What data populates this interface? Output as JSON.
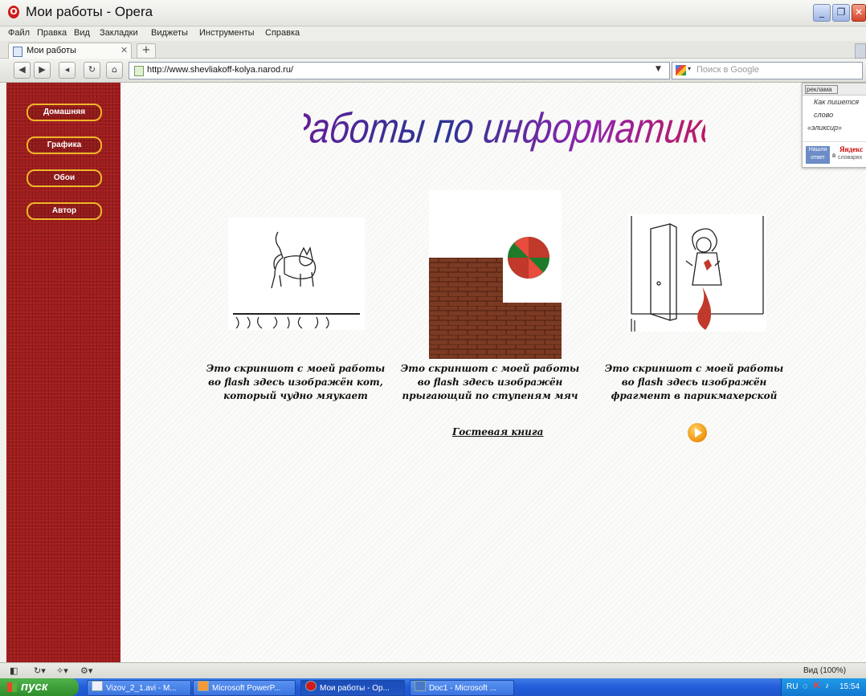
{
  "window": {
    "title": "Мои работы - Opera",
    "logo": "O",
    "buttons": [
      "_",
      "❐",
      "✕"
    ]
  },
  "menu": [
    "Файл",
    "Правка",
    "Вид",
    "Закладки",
    "Виджеты",
    "Инструменты",
    "Справка"
  ],
  "tabs": [
    {
      "label": "Мои работы",
      "close": "✕"
    }
  ],
  "tab_new": "+",
  "nav": {
    "back": "◀",
    "forward": "▶",
    "rewind": "◂",
    "reload": "↻",
    "home": "⌂",
    "url": "http://www.shevliakoff-kolya.narod.ru/",
    "url_dropdown": "▼",
    "search_caret": "▾",
    "search_placeholder": "Поиск в Google"
  },
  "sidebar": {
    "items": [
      "Домашняя",
      "Графика",
      "Обои",
      "Автор"
    ]
  },
  "heading": "Работы по информатике",
  "works": [
    {
      "caption": "Это скриншот с моей работы во flash здесь изображён кот, который чудно мяукает"
    },
    {
      "caption": "Это скриншот с моей работы во flash здесь изображён прыгающий по ступеням мяч"
    },
    {
      "caption": "Это скриншот с моей работы во flash здесь изображён фрагмент в парикмахерской"
    }
  ],
  "guestbook": "Гостевая книга",
  "ad": {
    "tag": "реклама",
    "lines": [
      "Как пишется",
      "слово",
      "«эликсир»"
    ],
    "blue": "Нашли ответ",
    "brand_pre": "в",
    "brand": "Яндекс",
    "brand_sub": "словарях"
  },
  "status": {
    "zoom": "Вид (100%)"
  },
  "taskbar": {
    "start": "пуск",
    "tasks": [
      "Vizov_2_1.avi - M...",
      "Microsoft PowerP...",
      "Мои работы - Op...",
      "Doc1 - Microsoft ..."
    ],
    "lang": "RU",
    "time": "15:54"
  },
  "colors": {
    "sidebar": "#9e1a1a",
    "button_border": "#f0b62a",
    "taskbar": "#245edb",
    "start": "#3a9a36"
  }
}
